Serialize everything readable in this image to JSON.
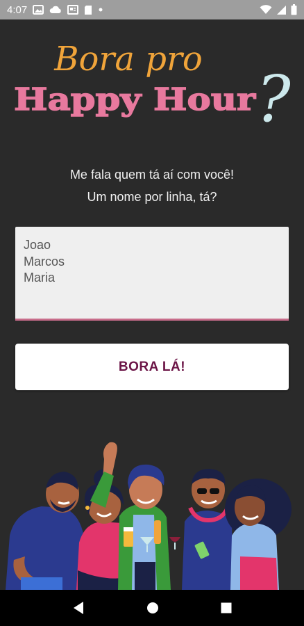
{
  "status_bar": {
    "time": "4:07"
  },
  "logo": {
    "line1": "Bora pro",
    "line2": "Happy Hour",
    "mark": "?"
  },
  "prompt": {
    "line1": "Me fala quem tá aí com você!",
    "line2": "Um nome por linha, tá?"
  },
  "names_input": {
    "value": "Joao\nMarcos\nMaria"
  },
  "go_button": {
    "label": "BORA LÁ!"
  },
  "colors": {
    "background": "#2a2a2a",
    "logo_orange": "#f0a43a",
    "logo_pink": "#e8799e",
    "logo_question": "#cde9ec",
    "button_text": "#6b1446",
    "input_underline": "#c86d8b"
  },
  "icons": [
    "gallery-icon",
    "cloud-icon",
    "news-icon",
    "sd-card-icon",
    "dot-icon",
    "wifi-icon",
    "signal-icon",
    "battery-icon",
    "back-icon",
    "home-icon",
    "recents-icon"
  ]
}
